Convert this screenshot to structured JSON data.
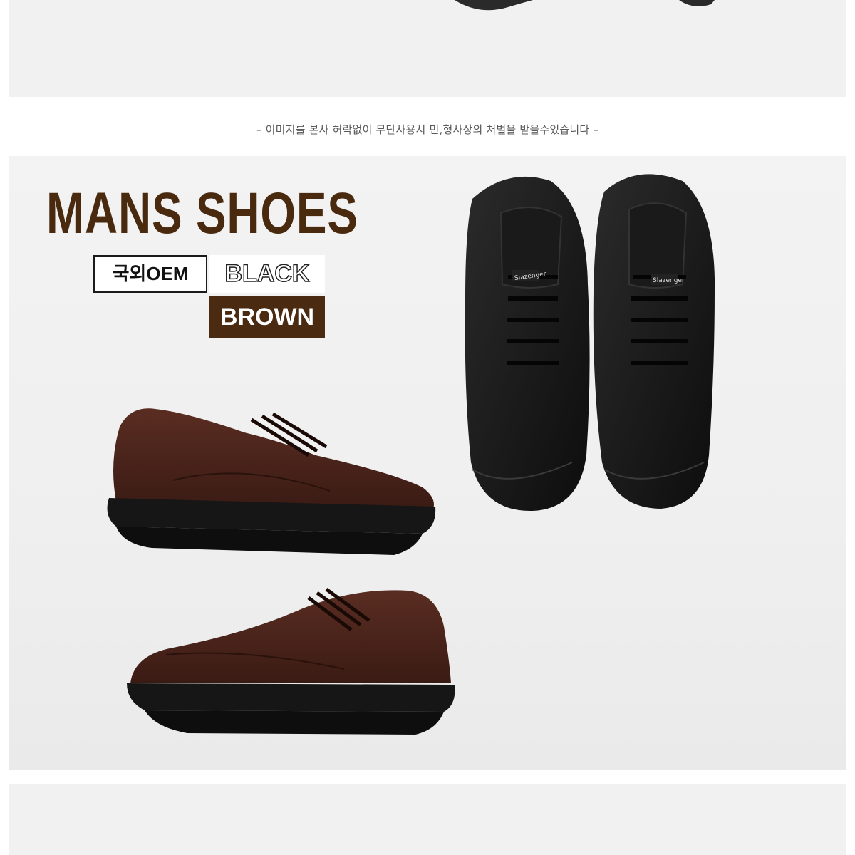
{
  "notice": "– 이미지를 본사 허락없이 무단사용시 민,형사상의 처벌을 받을수있습니다 –",
  "product": {
    "title": "MANS SHOES",
    "origin_badge": "국외OEM",
    "colors": [
      "BLACK",
      "BROWN"
    ]
  },
  "brand_logo": "Slazenger",
  "palette": {
    "title_brown": "#4a2a0f",
    "brown_badge": "#4a2a10",
    "background": "#efefef"
  }
}
